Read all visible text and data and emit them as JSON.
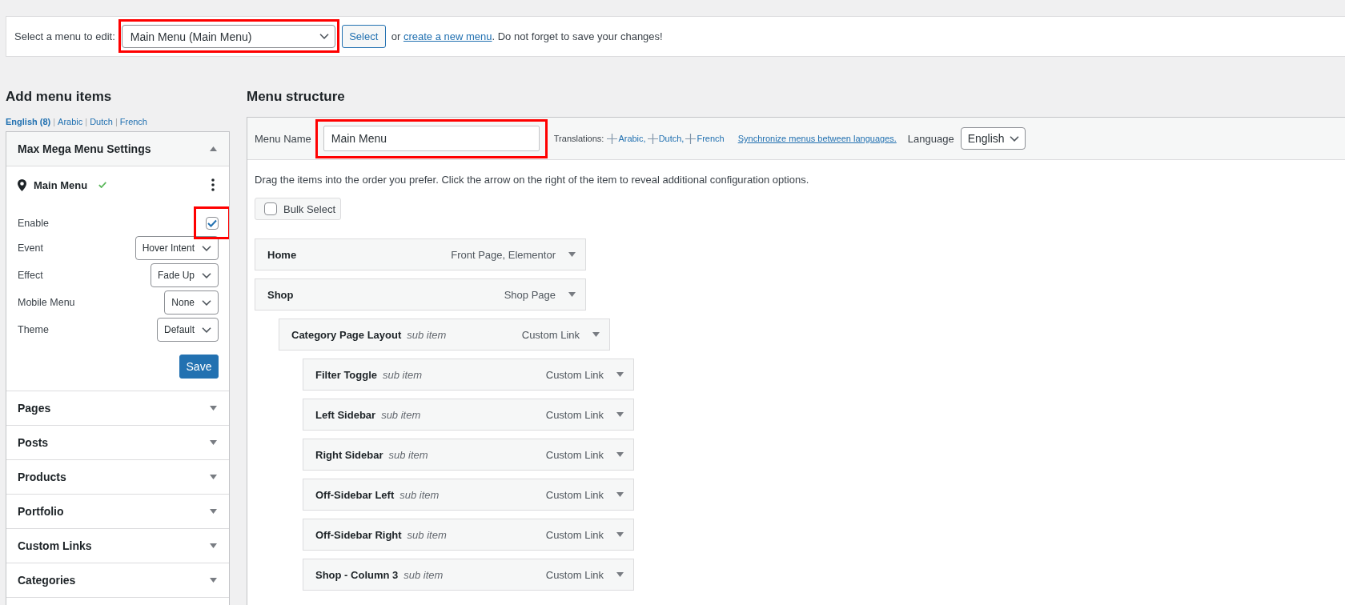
{
  "menu_picker": {
    "label": "Select a menu to edit:",
    "selected_menu": "Main Menu (Main Menu)",
    "highlighted": true,
    "button": "Select",
    "note_before": "or",
    "link": "create a new menu",
    "note_after": ". Do not forget to save your changes!"
  },
  "add_menu_items": {
    "title": "Add menu items",
    "languages": [
      {
        "label": "English (8)",
        "selected": true,
        "separator": "|"
      },
      {
        "label": "Arabic",
        "selected": false,
        "separator": "|"
      },
      {
        "label": "Dutch",
        "selected": false,
        "separator": "|"
      },
      {
        "label": "French",
        "selected": false
      }
    ],
    "mega_menu": {
      "title": "Max Mega Menu Settings",
      "expanded": true,
      "location": "Main Menu",
      "settings": [
        {
          "kind": "checkbox",
          "label": "Enable",
          "checked": true,
          "highlighted": true
        },
        {
          "kind": "select",
          "label": "Event",
          "value": "Hover Intent"
        },
        {
          "kind": "select",
          "label": "Effect",
          "value": "Fade Up"
        },
        {
          "kind": "select",
          "label": "Mobile Menu",
          "value": "None"
        },
        {
          "kind": "select",
          "label": "Theme",
          "value": "Default"
        }
      ],
      "save": "Save"
    },
    "sections": [
      {
        "title": "Pages",
        "expanded": false
      },
      {
        "title": "Posts",
        "expanded": false
      },
      {
        "title": "Products",
        "expanded": false
      },
      {
        "title": "Portfolio",
        "expanded": false
      },
      {
        "title": "Custom Links",
        "expanded": false
      },
      {
        "title": "Categories",
        "expanded": false
      }
    ]
  },
  "menu_structure": {
    "title": "Menu structure",
    "name_label": "Menu Name",
    "name_value": "Main Menu",
    "name_highlighted": true,
    "translations_label": "Translations:",
    "translations": [
      "Arabic,",
      "Dutch,",
      "French"
    ],
    "sync_link": "Synchronize menus between languages.",
    "language_label": "Language",
    "language": "English",
    "instructions": "Drag the items into the order you prefer. Click the arrow on the right of the item to reveal additional configuration options.",
    "bulk_select": {
      "label": "Bulk Select",
      "checked": false
    },
    "items": [
      {
        "title": "Home",
        "type": "Front Page, Elementor"
      },
      {
        "title": "Shop",
        "type": "Shop Page",
        "children": [
          {
            "title": "Category Page Layout",
            "note": "sub item",
            "type": "Custom Link",
            "children": [
              {
                "title": "Filter Toggle",
                "note": "sub item",
                "type": "Custom Link"
              },
              {
                "title": "Left Sidebar",
                "note": "sub item",
                "type": "Custom Link"
              },
              {
                "title": "Right Sidebar",
                "note": "sub item",
                "type": "Custom Link"
              },
              {
                "title": "Off-Sidebar Left",
                "note": "sub item",
                "type": "Custom Link"
              },
              {
                "title": "Off-Sidebar Right",
                "note": "sub item",
                "type": "Custom Link"
              },
              {
                "title": "Shop - Column 3",
                "note": "sub item",
                "type": "Custom Link"
              }
            ]
          }
        ]
      }
    ]
  }
}
